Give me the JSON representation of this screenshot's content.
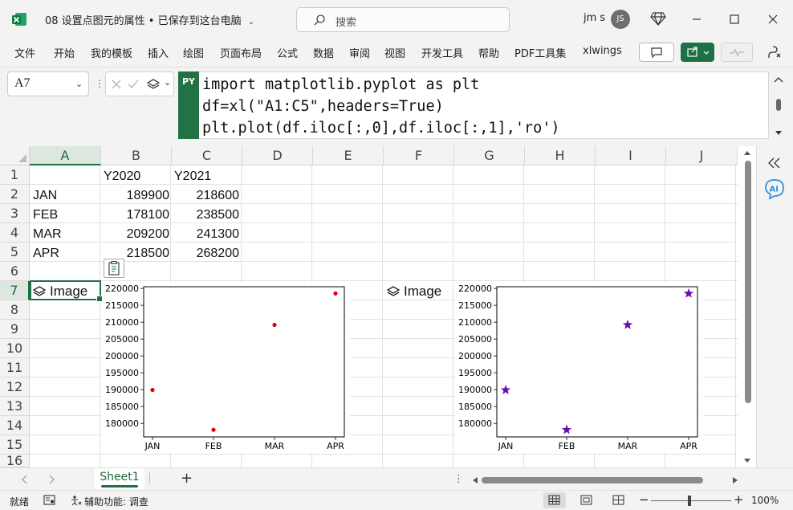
{
  "titlebar": {
    "doc_title": "08 设置点图元的属性 • 已保存到这台电脑",
    "search_placeholder": "搜索",
    "user_name": "jm s",
    "user_initials": "JS"
  },
  "ribbon": {
    "tabs": [
      "文件",
      "开始",
      "我的模板",
      "插入",
      "绘图",
      "页面布局",
      "公式",
      "数据",
      "审阅",
      "视图",
      "开发工具",
      "帮助",
      "PDF工具集",
      "xlwings"
    ]
  },
  "formula_bar": {
    "name_box": "A7",
    "badge": "PY",
    "code_lines": [
      "import matplotlib.pyplot as plt",
      "df=xl(\"A1:C5\",headers=True)",
      "plt.plot(df.iloc[:,0],df.iloc[:,1],'ro')"
    ]
  },
  "sheet": {
    "columns": [
      "A",
      "B",
      "C",
      "D",
      "E",
      "F",
      "G",
      "H",
      "I",
      "J"
    ],
    "rows": [
      "1",
      "2",
      "3",
      "4",
      "5",
      "6",
      "7",
      "8",
      "9",
      "10",
      "11",
      "12",
      "13",
      "14",
      "15",
      "16"
    ],
    "headers": {
      "b1": "Y2020",
      "c1": "Y2021"
    },
    "data": [
      {
        "month": "JAN",
        "y2020": "189900",
        "y2021": "218600"
      },
      {
        "month": "FEB",
        "y2020": "178100",
        "y2021": "238500"
      },
      {
        "month": "MAR",
        "y2020": "209200",
        "y2021": "241300"
      },
      {
        "month": "APR",
        "y2020": "218500",
        "y2021": "268200"
      }
    ],
    "image_label_a7": "Image",
    "image_label_f7": "Image"
  },
  "chart_data": [
    {
      "type": "scatter",
      "categories": [
        "JAN",
        "FEB",
        "MAR",
        "APR"
      ],
      "series": [
        {
          "values": [
            189900,
            178100,
            209200,
            218500
          ]
        }
      ],
      "y_ticks": [
        "180000",
        "185000",
        "190000",
        "195000",
        "200000",
        "205000",
        "210000",
        "215000",
        "220000"
      ],
      "ylim": [
        176000,
        220500
      ],
      "marker": "circle",
      "color": "#e00000"
    },
    {
      "type": "scatter",
      "categories": [
        "JAN",
        "FEB",
        "MAR",
        "APR"
      ],
      "series": [
        {
          "values": [
            189900,
            178100,
            209200,
            218500
          ]
        }
      ],
      "y_ticks": [
        "180000",
        "185000",
        "190000",
        "195000",
        "200000",
        "205000",
        "210000",
        "215000",
        "220000"
      ],
      "ylim": [
        176000,
        220500
      ],
      "marker": "star",
      "color": "#6a0dad"
    }
  ],
  "sheet_tabs": {
    "active": "Sheet1",
    "add_label": "+"
  },
  "statusbar": {
    "ready": "就绪",
    "accessibility": "辅助功能: 调查",
    "zoom_minus": "−",
    "zoom_plus": "+",
    "zoom": "100%"
  },
  "colors": {
    "accent": "#1e7145",
    "chrome": "#f3f3f3"
  }
}
